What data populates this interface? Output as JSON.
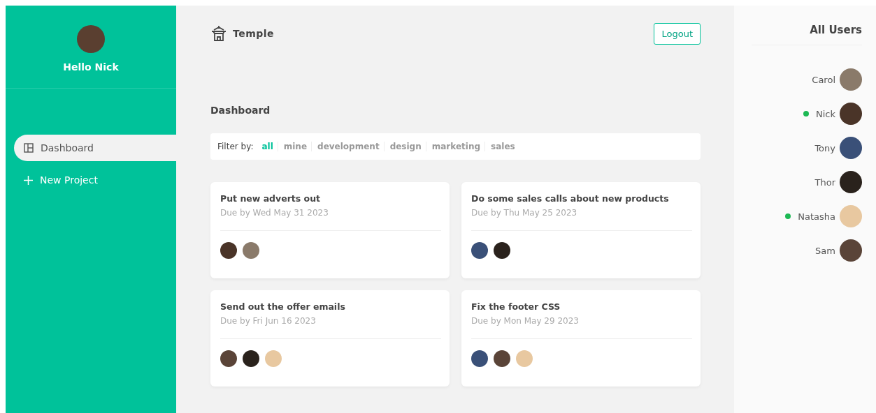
{
  "sidebar": {
    "greeting": "Hello Nick",
    "avatar": {
      "color": "#5a3f30"
    },
    "nav": [
      {
        "kind": "dashboard",
        "label": "Dashboard",
        "selected": true
      },
      {
        "kind": "add",
        "label": "New Project",
        "selected": false
      }
    ]
  },
  "header": {
    "logo_text": "Temple",
    "logout": "Logout"
  },
  "title": "Dashboard",
  "filter": {
    "label": "Filter by:",
    "options": [
      {
        "label": "all",
        "selected": true
      },
      {
        "label": "mine",
        "selected": false
      },
      {
        "label": "development",
        "selected": false
      },
      {
        "label": "design",
        "selected": false
      },
      {
        "label": "marketing",
        "selected": false
      },
      {
        "label": "sales",
        "selected": false
      }
    ]
  },
  "projects": [
    {
      "name": "Put new adverts out",
      "due": "Due by Wed May 31 2023",
      "avatars": [
        {
          "color": "#4a3428"
        },
        {
          "color": "#8a7a6a"
        }
      ]
    },
    {
      "name": "Do some sales calls about new products",
      "due": "Due by Thu May 25 2023",
      "avatars": [
        {
          "color": "#3a5078"
        },
        {
          "color": "#2a221c"
        }
      ]
    },
    {
      "name": "Send out the offer emails",
      "due": "Due by Fri Jun 16 2023",
      "avatars": [
        {
          "color": "#5a4438"
        },
        {
          "color": "#2a221c"
        },
        {
          "color": "#e8c8a0"
        }
      ]
    },
    {
      "name": "Fix the footer CSS",
      "due": "Due by Mon May 29 2023",
      "avatars": [
        {
          "color": "#3a5078"
        },
        {
          "color": "#5a4438"
        },
        {
          "color": "#e8c8a0"
        }
      ]
    }
  ],
  "users_panel": {
    "title": "All Users",
    "users": [
      {
        "name": "Carol",
        "online": false,
        "color": "#8a7a6a"
      },
      {
        "name": "Nick",
        "online": true,
        "color": "#4a3428"
      },
      {
        "name": "Tony",
        "online": false,
        "color": "#3a5078"
      },
      {
        "name": "Thor",
        "online": false,
        "color": "#2a221c"
      },
      {
        "name": "Natasha",
        "online": true,
        "color": "#e8c8a0"
      },
      {
        "name": "Sam",
        "online": false,
        "color": "#5a4438"
      }
    ]
  }
}
